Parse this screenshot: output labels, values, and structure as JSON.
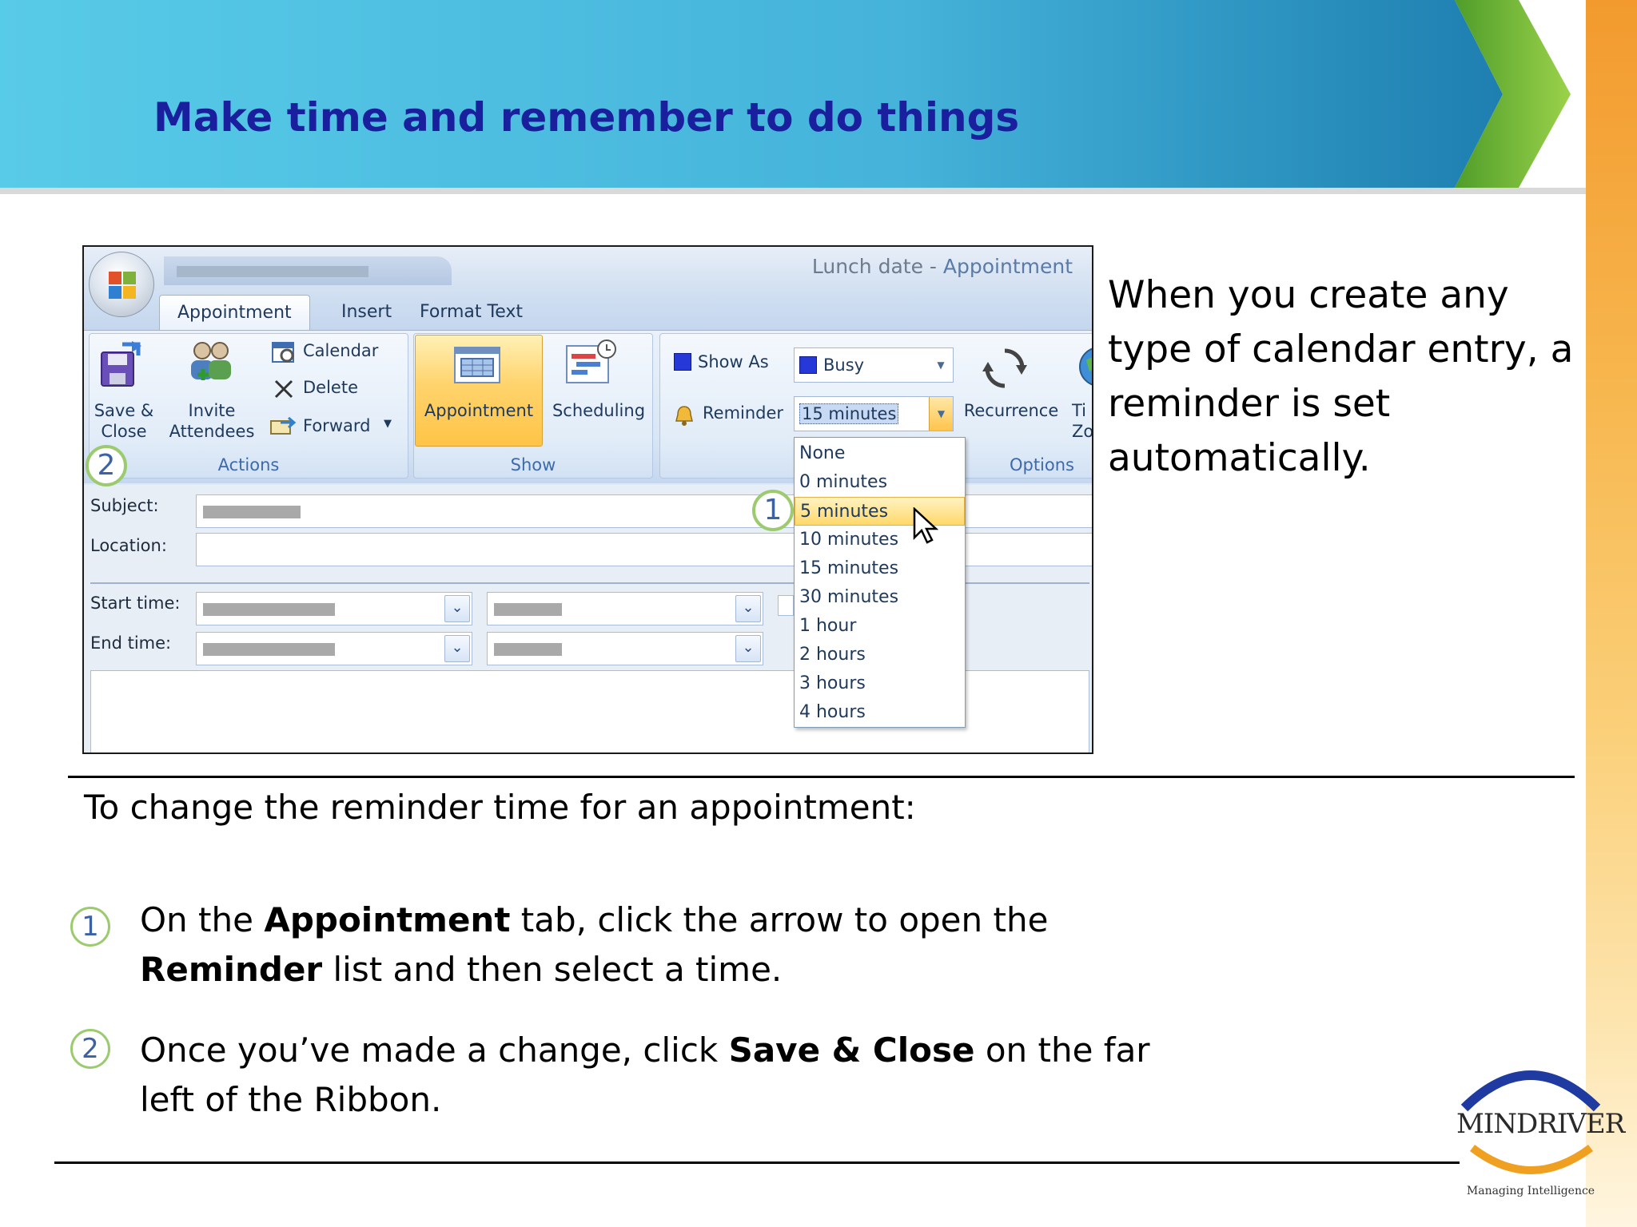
{
  "slide": {
    "title": "Make time and remember to do things",
    "side_text": "When you create any type of calendar entry, a reminder is set automatically.",
    "intro": "To change the reminder time for an appointment:",
    "steps": [
      {
        "number": "1",
        "parts": [
          "On the ",
          "Appointment",
          " tab, click the arrow to open the ",
          "Reminder",
          " list and then select a time."
        ]
      },
      {
        "number": "2",
        "parts": [
          "Once you’ve made a change, click ",
          "Save & Close",
          " on the far left of the Ribbon."
        ]
      }
    ]
  },
  "outlook": {
    "window_title_item": "Lunch date",
    "window_title_sep": " - ",
    "window_title_app": "Appointment",
    "tabs": [
      "Appointment",
      "Insert",
      "Format Text"
    ],
    "groups": {
      "actions": {
        "label": "Actions",
        "save_close": [
          "Save &",
          "Close"
        ],
        "invite": [
          "Invite",
          "Attendees"
        ],
        "calendar": "Calendar",
        "delete": "Delete",
        "forward": "Forward"
      },
      "show": {
        "label": "Show",
        "appointment": "Appointment",
        "scheduling": "Scheduling"
      },
      "options": {
        "label": "Options",
        "show_as_label": "Show As",
        "show_as_value": "Busy",
        "reminder_label": "Reminder",
        "reminder_value": "15 minutes",
        "recurrence": "Recurrence",
        "time_zones_partial": [
          "Ti",
          "Zo"
        ]
      }
    },
    "form": {
      "subject_label": "Subject:",
      "location_label": "Location:",
      "start_label": "Start time:",
      "end_label": "End time:"
    },
    "reminder_options": [
      "None",
      "0 minutes",
      "5 minutes",
      "10 minutes",
      "15 minutes",
      "30 minutes",
      "1 hour",
      "2 hours",
      "3 hours",
      "4 hours"
    ],
    "reminder_highlighted": "5 minutes",
    "callouts": [
      "1",
      "2"
    ]
  },
  "logo": {
    "name": "MINDRIVER",
    "tagline": "Managing Intelligence"
  },
  "colors": {
    "title": "#1a1f9e",
    "callout_ring": "#9ccb6f",
    "callout_text": "#3c62a6"
  }
}
